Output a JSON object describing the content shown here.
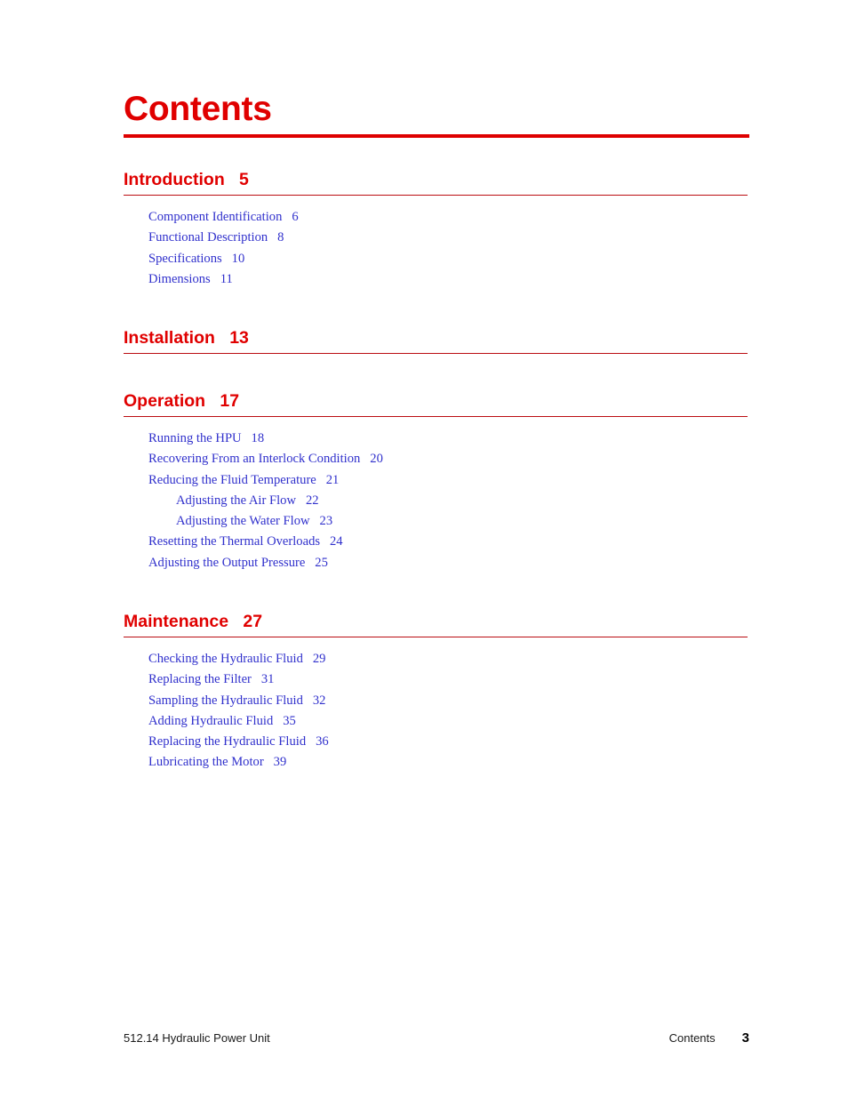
{
  "document": {
    "title": "Contents"
  },
  "chapters": [
    {
      "name": "Introduction",
      "page": "5",
      "entries": [
        {
          "label": "Component Identification",
          "page": "6",
          "level": 2
        },
        {
          "label": "Functional Description",
          "page": "8",
          "level": 2
        },
        {
          "label": "Specifications",
          "page": "10",
          "level": 2
        },
        {
          "label": "Dimensions",
          "page": "11",
          "level": 2
        }
      ]
    },
    {
      "name": "Installation",
      "page": "13",
      "entries": []
    },
    {
      "name": "Operation",
      "page": "17",
      "entries": [
        {
          "label": "Running the HPU",
          "page": "18",
          "level": 2
        },
        {
          "label": "Recovering From an Interlock Condition",
          "page": "20",
          "level": 2
        },
        {
          "label": "Reducing the Fluid Temperature",
          "page": "21",
          "level": 2
        },
        {
          "label": "Adjusting the Air Flow",
          "page": "22",
          "level": 3
        },
        {
          "label": "Adjusting the Water Flow",
          "page": "23",
          "level": 3
        },
        {
          "label": "Resetting the Thermal Overloads",
          "page": "24",
          "level": 2
        },
        {
          "label": "Adjusting the Output Pressure",
          "page": "25",
          "level": 2
        }
      ]
    },
    {
      "name": "Maintenance",
      "page": "27",
      "entries": [
        {
          "label": "Checking the Hydraulic Fluid",
          "page": "29",
          "level": 2
        },
        {
          "label": "Replacing the Filter",
          "page": "31",
          "level": 2
        },
        {
          "label": "Sampling the Hydraulic Fluid",
          "page": "32",
          "level": 2
        },
        {
          "label": "Adding Hydraulic Fluid",
          "page": "35",
          "level": 2
        },
        {
          "label": "Replacing the Hydraulic Fluid",
          "page": "36",
          "level": 2
        },
        {
          "label": "Lubricating the Motor",
          "page": "39",
          "level": 2
        }
      ]
    }
  ],
  "footer": {
    "manual": "512.14 Hydraulic Power Unit",
    "section": "Contents",
    "page": "3"
  },
  "colors": {
    "heading_red": "#e00000",
    "rule_red": "#bb0d12",
    "entry_blue": "#3030cc",
    "footer_text": "#1a1a1a"
  }
}
